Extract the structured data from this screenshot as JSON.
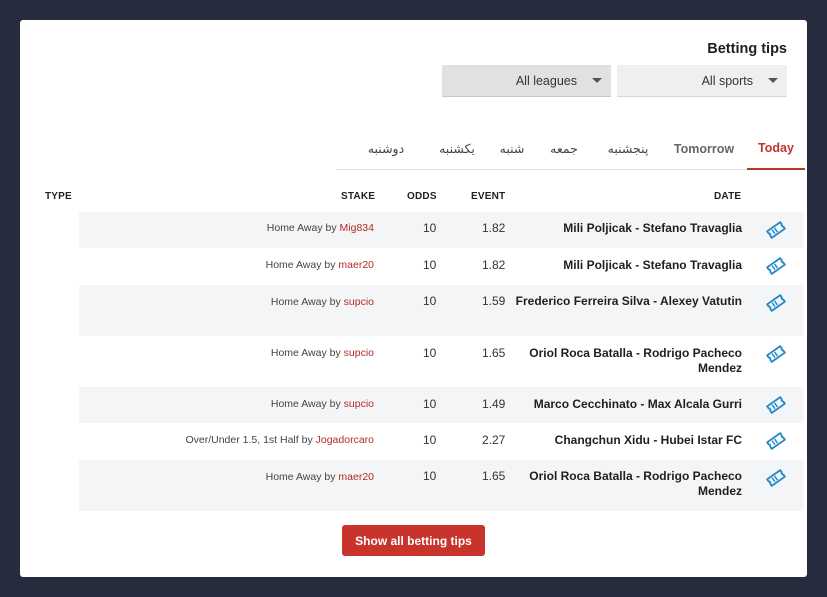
{
  "header": {
    "title": "Betting tips"
  },
  "filters": {
    "leagues_label": "All leagues",
    "sports_label": "All sports"
  },
  "tabs": [
    {
      "label": "دوشنبه",
      "active": false
    },
    {
      "label": "یکشنبه",
      "active": false
    },
    {
      "label": "شنبه",
      "active": false
    },
    {
      "label": "جمعه",
      "active": false
    },
    {
      "label": "پنجشنبه",
      "active": false
    },
    {
      "label": "Tomorrow",
      "active": false
    },
    {
      "label": "Today",
      "active": true
    }
  ],
  "table": {
    "headers": {
      "type": "TYPE",
      "stake": "STAKE",
      "odds": "ODDS",
      "event": "EVENT",
      "date": "DATE"
    },
    "rows": [
      {
        "market": "Home Away",
        "by": "by",
        "user": "Mig834",
        "stake": "10",
        "odds": "1.82",
        "event": "Mili Poljicak - Stefano Travaglia"
      },
      {
        "market": "Home Away",
        "by": "by",
        "user": "maer20",
        "stake": "10",
        "odds": "1.82",
        "event": "Mili Poljicak - Stefano Travaglia"
      },
      {
        "market": "Home Away",
        "by": "by",
        "user": "supcio",
        "stake": "10",
        "odds": "1.59",
        "event": "Frederico Ferreira Silva - Alexey Vatutin"
      },
      {
        "market": "Home Away",
        "by": "by",
        "user": "supcio",
        "stake": "10",
        "odds": "1.65",
        "event": "Oriol Roca Batalla - Rodrigo Pacheco Mendez"
      },
      {
        "market": "Home Away",
        "by": "by",
        "user": "supcio",
        "stake": "10",
        "odds": "1.49",
        "event": "Marco Cecchinato - Max Alcala Gurri"
      },
      {
        "market": "Over/Under 1.5, 1st Half",
        "by": "by",
        "user": "Jogadorcaro",
        "stake": "10",
        "odds": "2.27",
        "event": "Changchun Xidu - Hubei Istar FC"
      },
      {
        "market": "Home Away",
        "by": "by",
        "user": "maer20",
        "stake": "10",
        "odds": "1.65",
        "event": "Oriol Roca Batalla - Rodrigo Pacheco Mendez"
      }
    ]
  },
  "footer": {
    "show_all_label": "Show all betting tips"
  },
  "colors": {
    "accent": "#c8342c",
    "icon": "#1e88c9"
  }
}
